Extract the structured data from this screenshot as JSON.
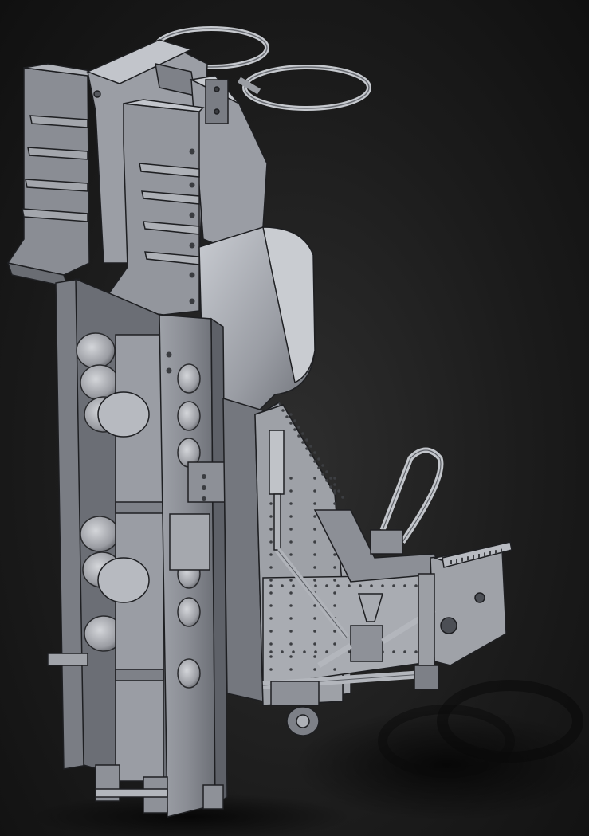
{
  "scene": {
    "subject": "ejection-seat-cad-render",
    "colors": {
      "background": "#1a1a1a",
      "metal_light": "#b4b7bd",
      "metal_mid": "#8e9198",
      "metal_dark": "#5c5f66",
      "edge": "#1e1f22",
      "shadow": "#0c0c0c"
    }
  }
}
